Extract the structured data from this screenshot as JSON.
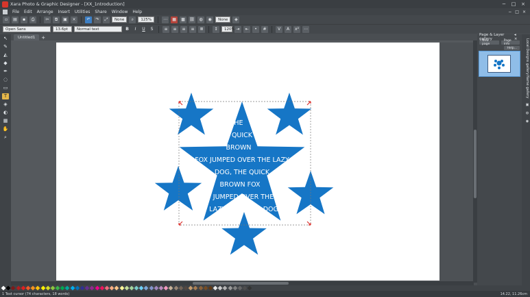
{
  "window": {
    "title": "Xara Photo & Graphic Designer - [XX_1ntroduction]",
    "controls": [
      "−",
      "□",
      "×"
    ]
  },
  "menu": {
    "items": [
      "File",
      "Edit",
      "Arrange",
      "Insert",
      "Utilities",
      "Share",
      "Window",
      "Help"
    ],
    "right_controls": [
      "−",
      "□",
      "×"
    ]
  },
  "toolbar": {
    "zoom_value": "None",
    "zoom_percent": "125%",
    "quality_value": "None"
  },
  "format_bar": {
    "font_name": "Open Sans",
    "font_size": "13.6pt",
    "style_name": "Normal text",
    "bold": "B",
    "italic": "I",
    "underline": "U",
    "strike": "S",
    "line_spacing": "120%"
  },
  "doc_tabs": [
    {
      "label": "Untitled1"
    }
  ],
  "doc_tab_add": "+",
  "artwork": {
    "text_lines": [
      "THE",
      "QUICK",
      "BROWN",
      "FOX JUMPED OVER THE LAZY",
      "DOG, THE QUICK",
      "BROWN FOX",
      "JUMPED OVER THE",
      "LAZY                  DOG,"
    ],
    "star_color": "#1676c6",
    "selection_color": "#d9302c"
  },
  "panel": {
    "title": "Page & Layer gallery",
    "pin": "◂ ×",
    "buttons": [
      "New page",
      "Page info"
    ],
    "help": "Help...",
    "vertical_tabs": [
      "Local Designs gallery",
      "Name gallery"
    ]
  },
  "palette": {
    "colors": [
      "#ffffff",
      "#000000",
      "#7a1a1a",
      "#b01e1e",
      "#e02020",
      "#f05a28",
      "#f7941d",
      "#ffc20e",
      "#fff200",
      "#d7df23",
      "#8dc63f",
      "#39b54a",
      "#00a651",
      "#00a99d",
      "#00aeef",
      "#0072bc",
      "#2e3192",
      "#662d91",
      "#92278f",
      "#ec008c",
      "#ed145b",
      "#f26d7d",
      "#f9ad81",
      "#fdc689",
      "#fff799",
      "#c4df9b",
      "#a3d39c",
      "#7accc8",
      "#6dcff6",
      "#7da7d9",
      "#8393ca",
      "#a187be",
      "#bd8cbf",
      "#f49ac1",
      "#c7b299",
      "#998675",
      "#736357",
      "#534741",
      "#c69c6d",
      "#a67c52",
      "#8c6239",
      "#754c24",
      "#603913",
      "#e6e6e6",
      "#cccccc",
      "#b3b3b3",
      "#999999",
      "#808080",
      "#666666",
      "#4d4d4d",
      "#333333"
    ]
  },
  "status": {
    "message": "1 Text cursor (74 characters, 18 words)",
    "coords": "14.22, 11.26cm"
  }
}
